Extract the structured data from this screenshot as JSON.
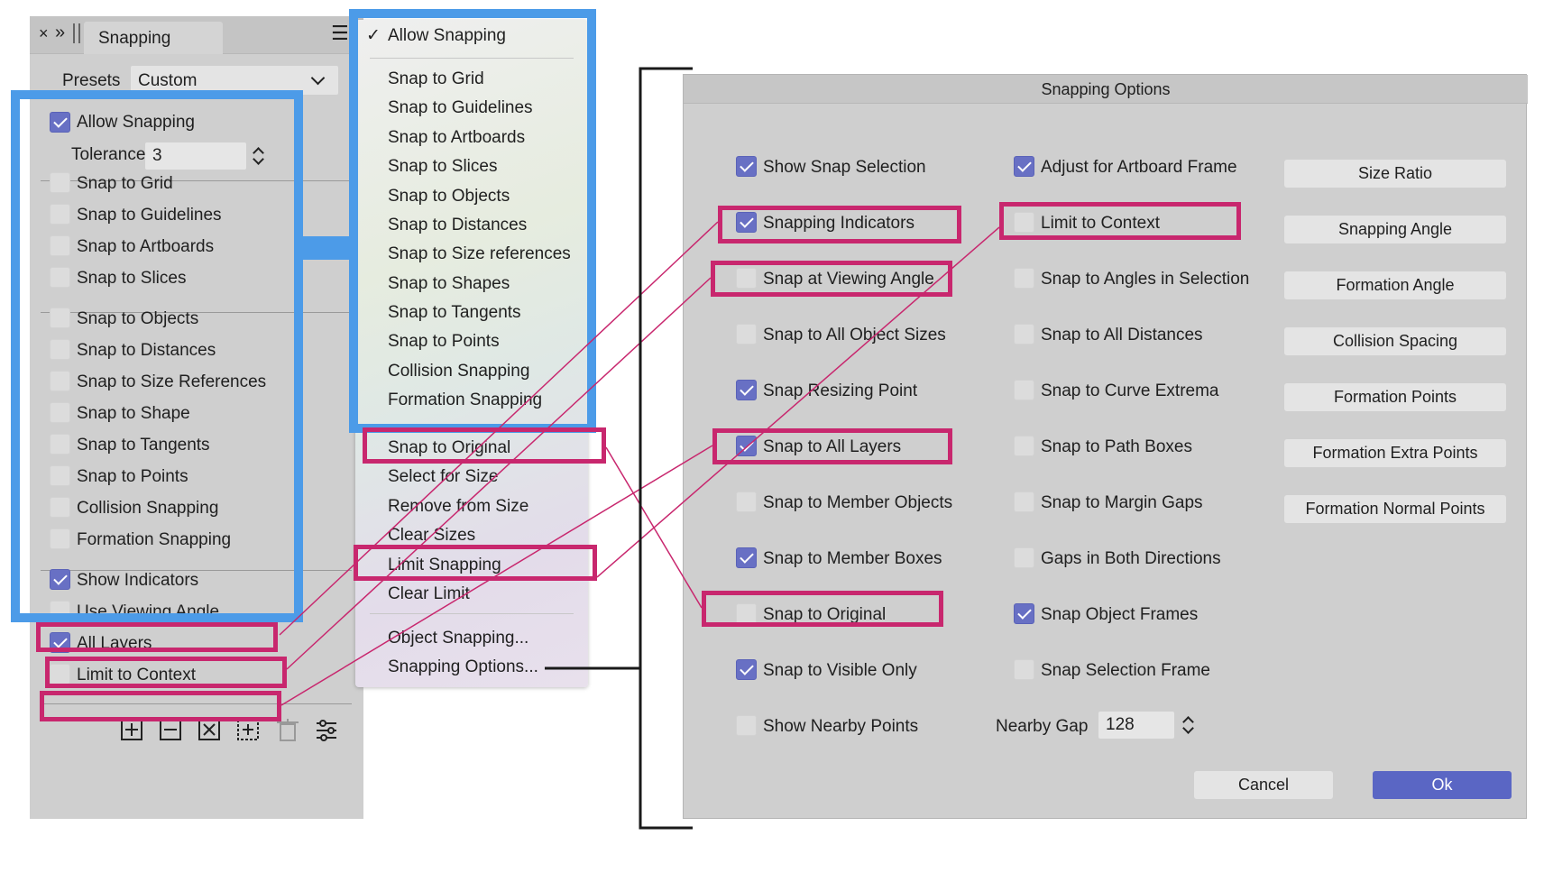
{
  "panel": {
    "title": "Snapping",
    "close_glyph": "×",
    "collapse_glyph": "»",
    "menu_glyph": "☰",
    "presets_label": "Presets",
    "presets_value": "Custom",
    "allow_snapping": "Allow Snapping",
    "tolerance_label": "Tolerance",
    "tolerance_value": "3",
    "items": [
      {
        "label": "Snap to Grid",
        "checked": false
      },
      {
        "label": "Snap to Guidelines",
        "checked": false
      },
      {
        "label": "Snap to Artboards",
        "checked": false
      },
      {
        "label": "Snap to Slices",
        "checked": false
      },
      {
        "label": "Snap to Objects",
        "checked": false
      },
      {
        "label": "Snap to Distances",
        "checked": false
      },
      {
        "label": "Snap to Size References",
        "checked": false
      },
      {
        "label": "Snap to Shape",
        "checked": false
      },
      {
        "label": "Snap to Tangents",
        "checked": false
      },
      {
        "label": "Snap to Points",
        "checked": false
      },
      {
        "label": "Collision Snapping",
        "checked": false
      },
      {
        "label": "Formation Snapping",
        "checked": false
      },
      {
        "label": "Show Indicators",
        "checked": true
      },
      {
        "label": "Use Viewing Angle",
        "checked": false
      },
      {
        "label": "All Layers",
        "checked": true
      },
      {
        "label": "Limit to Context",
        "checked": false
      }
    ],
    "toolbar_icons": [
      "add-icon",
      "remove-icon",
      "delete-icon",
      "snap-target-icon",
      "trash-icon",
      "settings-icon"
    ]
  },
  "menu": {
    "checkmark": "✓",
    "items": [
      "Allow Snapping",
      "Snap to Grid",
      "Snap to Guidelines",
      "Snap to Artboards",
      "Snap to Slices",
      "Snap to Objects",
      "Snap to Distances",
      "Snap to Size references",
      "Snap to Shapes",
      "Snap to Tangents",
      "Snap to Points",
      "Collision Snapping",
      "Formation Snapping",
      "Snap to Original",
      "Select for Size",
      "Remove from Size",
      "Clear Sizes",
      "Limit Snapping",
      "Clear Limit",
      "Object Snapping...",
      "Snapping Options..."
    ]
  },
  "dialog": {
    "title": "Snapping Options",
    "col1": [
      {
        "label": "Show Snap Selection",
        "checked": true
      },
      {
        "label": "Snapping Indicators",
        "checked": true
      },
      {
        "label": "Snap at Viewing Angle",
        "checked": false
      },
      {
        "label": "Snap to All Object Sizes",
        "checked": false
      },
      {
        "label": "Snap Resizing Point",
        "checked": true
      },
      {
        "label": "Snap to All Layers",
        "checked": true
      },
      {
        "label": "Snap to Member Objects",
        "checked": false
      },
      {
        "label": "Snap to Member Boxes",
        "checked": true
      },
      {
        "label": "Snap to Original",
        "checked": false
      },
      {
        "label": "Snap to Visible Only",
        "checked": true
      },
      {
        "label": "Show Nearby Points",
        "checked": false
      }
    ],
    "col2": [
      {
        "label": "Adjust for Artboard Frame",
        "checked": true
      },
      {
        "label": "Limit to Context",
        "checked": false
      },
      {
        "label": "Snap to Angles in Selection",
        "checked": false
      },
      {
        "label": "Snap to All Distances",
        "checked": false
      },
      {
        "label": "Snap to Curve Extrema",
        "checked": false
      },
      {
        "label": "Snap to Path Boxes",
        "checked": false
      },
      {
        "label": "Snap to Margin Gaps",
        "checked": false
      },
      {
        "label": "Gaps in Both Directions",
        "checked": false
      },
      {
        "label": "Snap Object Frames",
        "checked": true
      },
      {
        "label": "Snap Selection Frame",
        "checked": false
      }
    ],
    "nearby_gap_label": "Nearby Gap",
    "nearby_gap_value": "128",
    "buttons": [
      "Size Ratio",
      "Snapping Angle",
      "Formation Angle",
      "Collision Spacing",
      "Formation Points",
      "Formation Extra Points",
      "Formation Normal Points"
    ],
    "cancel": "Cancel",
    "ok": "Ok"
  },
  "colors": {
    "blue_highlight": "#4c9be8",
    "pink_highlight": "#c8276e",
    "checkbox_on": "#6870c4",
    "ok_button": "#5a66c4"
  }
}
